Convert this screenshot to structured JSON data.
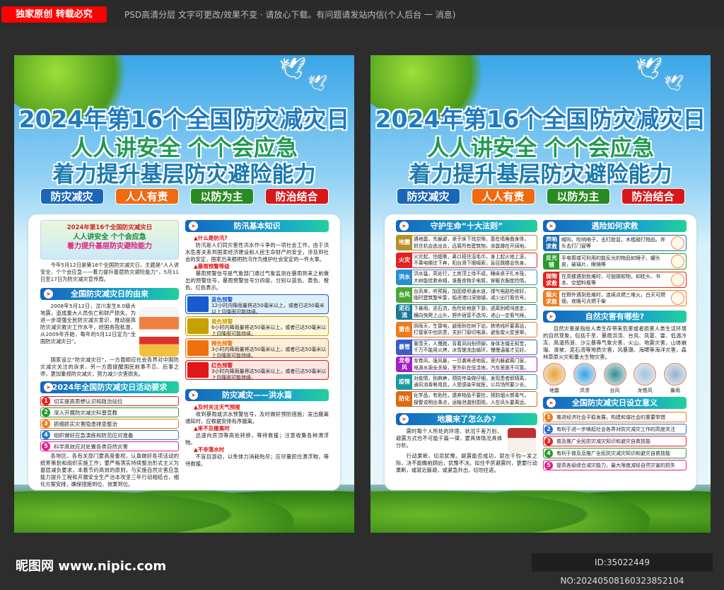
{
  "topbar": {
    "badge": "独家原创 转载必究",
    "notice": "PSD高清分层 文字可更改/效果不变 · 请放心下载。有问题请发站内信(个人后台 一 消息)"
  },
  "poster": {
    "title_line1": "2024年第16个全国防灾减灾日",
    "title_line2": "人人讲安全 个个会应急",
    "title_line3": "着力提升基层防灾避险能力",
    "pills": [
      {
        "label": "防灾减灾",
        "color": "#1a66b8"
      },
      {
        "label": "人人有责",
        "color": "#f06a10"
      },
      {
        "label": "以防为主",
        "color": "#2a8a22"
      },
      {
        "label": "防治结合",
        "color": "#d81818"
      }
    ]
  },
  "p1": {
    "banner": {
      "line1": "2024年第16个全国防灾减灾日",
      "line2": "人人讲安全 个个会应急",
      "line3": "着力提升基层防灾避险能力"
    },
    "intro": "今年5月12日是第16个全国防灾减灾日，主题是“人人讲安全、个个会应急——着力提升基层防灾避险能力”，5月11日至17日为防灾减灾宣传周。",
    "origin_title": "全国防灾减灾日的由来",
    "origin_text1": "2008年5月12日，汶川发生8.0级大地震，造成重大人员伤亡和财产损失。为进一步增强全民防灾减灾意识，推动提高防灾减灾救灾工作水平，经国务院批准，从2009年开始，每年的5月12日定为“全国防灾减灾日”。",
    "origin_text2": "国家设立“防灾减灾日”，一方面顺应社会各界对中国防灾减灾关注的诉求，另一方面提醒国民前事不忘、后事之师，更加重视防灾减灾，努力减少灾害损失。",
    "req_title": "2024年全国防灾减灾日活动要求",
    "req_items": [
      {
        "n": "1",
        "text": "切实提高思想认识和政治站位",
        "color": "#e52020"
      },
      {
        "n": "2",
        "text": "深入开展防灾减灾科普宣教",
        "color": "#2a9a2a"
      },
      {
        "n": "3",
        "text": "抓细抓实灾害隐患排查整治",
        "color": "#f07a1a"
      },
      {
        "n": "4",
        "text": "组织做好应急演练和防范应对准备",
        "color": "#2a7ad0"
      },
      {
        "n": "5",
        "text": "科学高效应对处置各类自然灾害",
        "color": "#e0208a"
      }
    ],
    "req_text": "各地区、各有关部门要高度重视，认真做好各项活动的统筹策划和组织实施工作；要严格落实持续整治形式主义为基层减负要求，本着节约高效的原则，与实施自然灾害应急能力提升工程和开展安全生产治本攻坚三年行动相结合，细化方案安排，确保措施到位、效果到位。",
    "flood_title": "防汛基本知识",
    "q1": "▲什么是防汛?",
    "a1": "防汛是人们同灾害性洪水作斗争的一项社会工作。由于洪水危害关系到国家经济建设和人民生命财产的安全，涉及到社会的安定，国家历来都把防汛作为维护社会安定的一件大事。",
    "q2": "▲暴雨预警等级",
    "a2": "暴雨预警信号是气象部门通过气象监测在暴雨到来之前做出的预警信号，暴雨预警信号分四级，分别以蓝色、黄色、橙色、红色表示。",
    "warnings": [
      {
        "title": "蓝色预警",
        "text": "12小时内降雨量将达50毫米以上，或者已达50毫米以上且降雨可能持续。",
        "color": "#1a5ad0",
        "bg": "#dff0fc"
      },
      {
        "title": "黄色预警",
        "text": "6小时内降雨量将达50毫米以上，或者已达50毫米以上且降雨可能持续。",
        "color": "#c8a000",
        "bg": "#fbf6dc"
      },
      {
        "title": "橙色预警",
        "text": "3小时内降雨量将达50毫米以上，或者已达50毫米以上且降雨可能持续。",
        "color": "#f07010",
        "bg": "#fdeedc"
      },
      {
        "title": "红色预警",
        "text": "3小时内降雨量将达50毫米以上，或者已达50毫米以上且降雨可能持续。",
        "color": "#e01818",
        "bg": "#fde6e4"
      }
    ],
    "flood2_title": "防灾减灾——洪水篇",
    "f_q1": "▲及时关注天气预报",
    "f_a1": "收到暴雨或洪水预警信号，及时做好预防措施；发出撤离通知时，应根据安排有序撤离。",
    "f_q2": "▲来不及撤离时",
    "f_a2": "迅速向房顶等高处转移，等待救援；注意收集各种漂浮物。",
    "f_q3": "▲不幸落水时",
    "f_a3": "不盲目游动，以免体力消耗殆尽；应尽量抓住漂浮物，等待救援。"
  },
  "p2": {
    "rules_title": "守护生命“十大法则”",
    "rules": [
      {
        "label": "地震",
        "l1": "遇地震，先躲避，桌子床下找空隙，靠在墙角曲身体，",
        "l2": "抓住机会逃出去，远离所有建筑物，余震蹲在开阔地。",
        "color": "#b89028"
      },
      {
        "label": "火灾",
        "l1": "火灾起，怕烟熏，鼻口捂住湿毛巾，身上起火地上滚，",
        "l2": "不乘电梯往下奔，阳台滑下捆绳索，盲目跳楼会伤身。",
        "color": "#e52222"
      },
      {
        "label": "洪水",
        "l1": "洪水猛，高处行，土房顶上待不成，睡床桌子扎木筏，",
        "l2": "大树能拴救命绳，准备食物手电筒，穿暖衣服度险情。",
        "color": "#2a8fd0"
      },
      {
        "label": "台风",
        "l1": "台风来，听预报，加固堤坝通水道，煤气电路检修好，",
        "l2": "临时建筑整牢靠，船进港口深抛锚，减少出行看信号。",
        "color": "#4aa832"
      },
      {
        "label": "泥石流",
        "l1": "下暴雨，泥石流，危险处地是下游，逃离别顺沟底走，",
        "l2": "横向快爬上山头，野外宿营不选沟，进山一定看气候。",
        "color": "#1a7a96"
      },
      {
        "label": "雷击",
        "l1": "阴雨天，生雷电，避雨别在树下站，铁塔线杆要离远，",
        "l2": "打雷家中也防患，关好门窗切电源，避免雷火屋里窜。",
        "color": "#f07a1a"
      },
      {
        "label": "暴雪",
        "l1": "暴雪天，人慢跑，背着风向别停脚，身体冻僵无知觉，",
        "l2": "千万不能用火烤，冰雪搓洗血循环，慢慢温暖才见好。",
        "color": "#3a5cc8"
      },
      {
        "label": "龙卷风",
        "l1": "龙卷风，强风暴，一旦袭来进地窖，室内躲避离门窗，",
        "l2": "电源水源全关掉，室外趴在低洼地，汽车里面不可靠。",
        "color": "#a020c0"
      },
      {
        "label": "疫情",
        "l1": "对疫情，别麻痹，预防传染做仔细，发现患者即隔离，",
        "l2": "通风消毒餐用具，人受感染早就医，公共场所要少去。",
        "color": "#1a9aa0"
      },
      {
        "label": "防化",
        "l1": "化学品，有危险，遗弃物品不要捡，预防烟火燃毒气，",
        "l2": "报警说明出事点，运输泄漏别围观，人在风头要离远。",
        "color": "#e06a10"
      }
    ],
    "quake_title": "地震来了怎么办?",
    "quake_text1": "震时每个人所处的环境、状况千差万别，避震方式也不可能千篇一律，要具体情况具体分析。",
    "quake_text2": "行动果断、切忌犹豫。避震能否成功，就在千钧一发之际，决不能瞻前顾后，犹豫不决。如住平房避震时，更要行动果断，或就近躲避，或紧急外出，切勿往返。",
    "rescue_title": "遇险如何求救",
    "rescue": [
      {
        "label": "声响求救",
        "text": "喊叫、吹响哨子，击打脸盆，木棍敲打物品、斧头击打门窗等",
        "color": "#1a6ab0"
      },
      {
        "label": "反光镜",
        "text": "手电筒或可利用的能反光的物品如镜子、罐头皮，破璃片，眼镜等",
        "color": "#2a9a2a"
      },
      {
        "label": "抛物求救",
        "text": "在高楼遇到危难时，可抛掷软物，如枕头、书本、空塑料瓶等",
        "color": "#e52020"
      },
      {
        "label": "烟火求救",
        "text": "在野外遇到危难时，连续点燃三堆火，白天可燃烟，夜晚可点燃干柴",
        "color": "#f07a1a"
      }
    ],
    "nature_title": "自然灾害有哪些?",
    "nature_text": "自然灾害是指给人类生存带来危害或者损害人类生活环境的自然现象，包括干旱、暴雨洪涝、台风、风雹、雷、低温冷冻、高温热浪、沙尘暴等气象灾害，火山、地震灾害，山体崩塌、滑坡、泥石流等地质灾害，风暴潮、海啸等海洋灾害，森林草原火灾和重大生物灾害。",
    "disasters": [
      {
        "label": "地震",
        "color": "#f0a030"
      },
      {
        "label": "洪涝",
        "color": "#3aa0e0"
      },
      {
        "label": "台风",
        "color": "#3a8a8a"
      },
      {
        "label": "龙卷风",
        "color": "#a8c0d8"
      },
      {
        "label": "暴雨",
        "color": "#9ab0c8"
      }
    ],
    "meaning_title": "全国防灾减灾日设立意义",
    "meaning": [
      {
        "n": "1",
        "text": "推进经济社会平稳发展，构建和谐社会的重要举措",
        "color": "#f07a1a"
      },
      {
        "n": "2",
        "text": "有利于进一步唤起社会各界对防灾减灾工作的高度关注",
        "color": "#2a6ad0"
      },
      {
        "n": "3",
        "text": "普及推广全民防灾减灾知识和避灾自救技能",
        "color": "#e52020"
      },
      {
        "n": "4",
        "text": "有利于普及及推广全民防灾减灾知识和避灾自救技能",
        "color": "#2a9a2a"
      },
      {
        "n": "5",
        "text": "提高各级综合减灾能力，最大限度减轻自然灾害的损失",
        "color": "#e0208a"
      }
    ]
  },
  "footer": {
    "logo": "昵图网 www.nipic.com",
    "id": "ID:35022449 NO:20240508160323852104"
  }
}
